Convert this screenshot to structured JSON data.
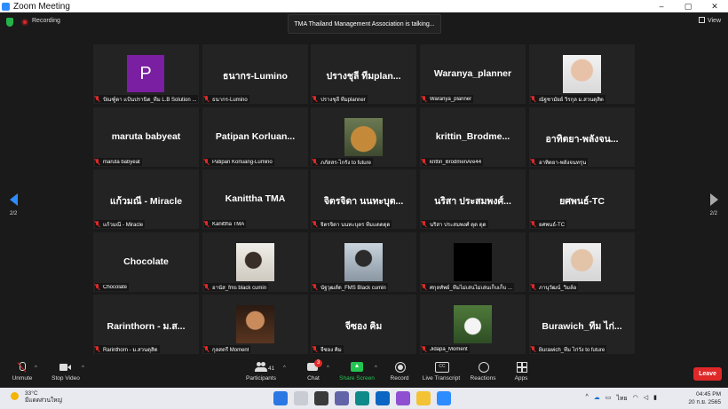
{
  "window": {
    "title": "Zoom Meeting",
    "controls": [
      "–",
      "▢",
      "✕"
    ]
  },
  "meeting": {
    "recording_label": "Recording",
    "speaking_banner": "TMA Thailand Management Association is talking...",
    "view_label": "View",
    "page_indicator": "2/2"
  },
  "tiles": [
    {
      "big": "",
      "avatar": "P",
      "photo": "",
      "label": "ปัณฑ์ูดา แป้นปรานิต_ทีม L.B Solution ..."
    },
    {
      "big": "ธนากร-Lumino",
      "avatar": "",
      "photo": "",
      "label": "ธนากร-Lumino"
    },
    {
      "big": "ปรางชุลี ทีมplan...",
      "avatar": "",
      "photo": "",
      "label": "ปรางชุลี ทีมplanner"
    },
    {
      "big": "Waranya_planner",
      "avatar": "",
      "photo": "",
      "label": "Waranya_planner"
    },
    {
      "big": "",
      "avatar": "",
      "photo": "woman",
      "label": "ณัฐชามัยย์ วิรกุล ม.สวนดุสิต"
    },
    {
      "big": "maruta babyeat",
      "avatar": "",
      "photo": "",
      "label": "maruta babyeat"
    },
    {
      "big": "Patipan Korluan...",
      "avatar": "",
      "photo": "",
      "label": "Patipan Korluang-Lumino"
    },
    {
      "big": "",
      "avatar": "",
      "photo": "dog",
      "label": "ภภัสสร-ไกรัง to future"
    },
    {
      "big": "krittin_Brodme...",
      "avatar": "",
      "photo": "",
      "label": "krittin_BrodmenAre44"
    },
    {
      "big": "อาทิตยา-พลังจน...",
      "avatar": "",
      "photo": "",
      "label": "อาทิตยา-พลังจนทรุน"
    },
    {
      "big": "แก้วมณี - Miracle",
      "avatar": "",
      "photo": "",
      "label": "แก้วมณี - Miracle"
    },
    {
      "big": "Kanittha TMA",
      "avatar": "",
      "photo": "",
      "label": "Kanittha TMA"
    },
    {
      "big": "จิตรจิดา นนทะบุต...",
      "avatar": "",
      "photo": "",
      "label": "จิตรจิดา นนทะบุตร ทีมแดดดุด"
    },
    {
      "big": "นริสา ประสมพงศ์...",
      "avatar": "",
      "photo": "",
      "label": "นริสา ประสมพงศ์ ดุด ดุด"
    },
    {
      "big": "ยศพนธ์-TC",
      "avatar": "",
      "photo": "",
      "label": "ยศพนธ์-TC"
    },
    {
      "big": "Chocolate",
      "avatar": "",
      "photo": "",
      "label": "Chocolate"
    },
    {
      "big": "",
      "avatar": "",
      "photo": "boy",
      "label": "อานัส_fms black cumin"
    },
    {
      "big": "",
      "avatar": "",
      "photo": "man",
      "label": "นัฐวุฒส์ด_FMS Black cumin"
    },
    {
      "big": "",
      "avatar": "",
      "photo": "black",
      "label": "ศกุลทัพย์_ทีมไม่เล่นไม่เล่นเก็บเก็บ ..."
    },
    {
      "big": "",
      "avatar": "",
      "photo": "glasses",
      "label": "ภานุวัฒน์_วิมล์อ"
    },
    {
      "big": "Rarinthorn - ม.ส...",
      "avatar": "",
      "photo": "",
      "label": "Rarinthorn - ม.สวนดุสิต"
    },
    {
      "big": "",
      "avatar": "",
      "photo": "candle",
      "label": "กุลสตรี Moment"
    },
    {
      "big": "จีซอง คิม",
      "avatar": "",
      "photo": "",
      "label": "จีซอง คิม"
    },
    {
      "big": "",
      "avatar": "",
      "photo": "field",
      "label": "Jidapa_Moment"
    },
    {
      "big": "Burawich_ทีม ไก่...",
      "avatar": "",
      "photo": "",
      "label": "Burawich_ทีม ไก่วัง to future"
    }
  ],
  "toolbar": {
    "unmute": "Unmute",
    "stop_video": "Stop Video",
    "participants": "Participants",
    "participants_count": "41",
    "chat": "Chat",
    "chat_badge": "3",
    "share_screen": "Share Screen",
    "record": "Record",
    "live_transcript": "Live Transcript",
    "reactions": "Reactions",
    "apps": "Apps",
    "leave": "Leave"
  },
  "taskbar": {
    "temperature": "33°C",
    "weather_text": "มีแดดส่วนใหญ่",
    "lang": "ไทย",
    "time": "04:45 PM",
    "date": "20 ก.ย. 2565"
  },
  "colors": {
    "zoom_blue": "#2d8cff",
    "muted_red": "#e02828",
    "share_green": "#23c552",
    "avatar_purple": "#7a1fa2"
  }
}
